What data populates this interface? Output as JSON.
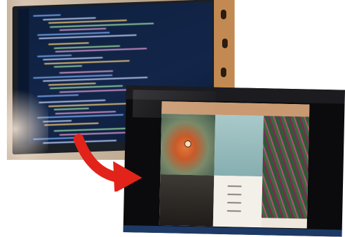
{
  "scene": {
    "photo_left": {
      "subject": "code-editor-monitor-photo"
    },
    "photo_right": {
      "subject": "website-on-monitor-photo"
    },
    "arrow": {
      "color": "#e2231a",
      "direction": "down-right"
    }
  },
  "colors": {
    "code_bg": "#13264a",
    "site_header": "#c99a72",
    "arrow": "#e2231a"
  }
}
